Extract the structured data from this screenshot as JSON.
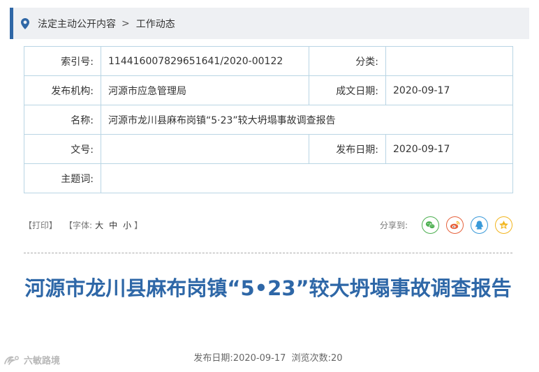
{
  "breadcrumb": {
    "items": [
      "法定主动公开内容",
      "工作动态"
    ],
    "separator": ">"
  },
  "meta": {
    "index_label": "索引号:",
    "index_value": "114416007829651641/2020-00122",
    "category_label": "分类:",
    "category_value": "",
    "publisher_label": "发布机构:",
    "publisher_value": "河源市应急管理局",
    "created_label": "成文日期:",
    "created_value": "2020-09-17",
    "name_label": "名称:",
    "name_value": "河源市龙川县麻布岗镇“5·23”较大坍塌事故调查报告",
    "docno_label": "文号:",
    "docno_value": "",
    "pubdate_label": "发布日期:",
    "pubdate_value": "2020-09-17",
    "keywords_label": "主题词:",
    "keywords_value": ""
  },
  "tools": {
    "print": "【打印】",
    "font_prefix": "【字体:",
    "font_large": "大",
    "font_medium": "中",
    "font_small": "小",
    "font_suffix": "】",
    "share_label": "分享到:"
  },
  "colors": {
    "accent": "#2f67a6",
    "title": "#2e67a7",
    "border": "#b9d5e4",
    "wechat": "#4caf50",
    "weibo": "#e6623c",
    "qq": "#3a9ad9",
    "qzone": "#f2b51d"
  },
  "share_icons": [
    "wechat-icon",
    "weibo-icon",
    "qq-icon",
    "qzone-icon"
  ],
  "article": {
    "title": "河源市龙川县麻布岗镇“5•23”较大坍塌事故调查报告",
    "pubdate_label": "发布日期:",
    "pubdate_value": "2020-09-17",
    "views_label": "浏览次数:",
    "views_value": "20"
  },
  "watermark": {
    "text": "六敏路境"
  }
}
